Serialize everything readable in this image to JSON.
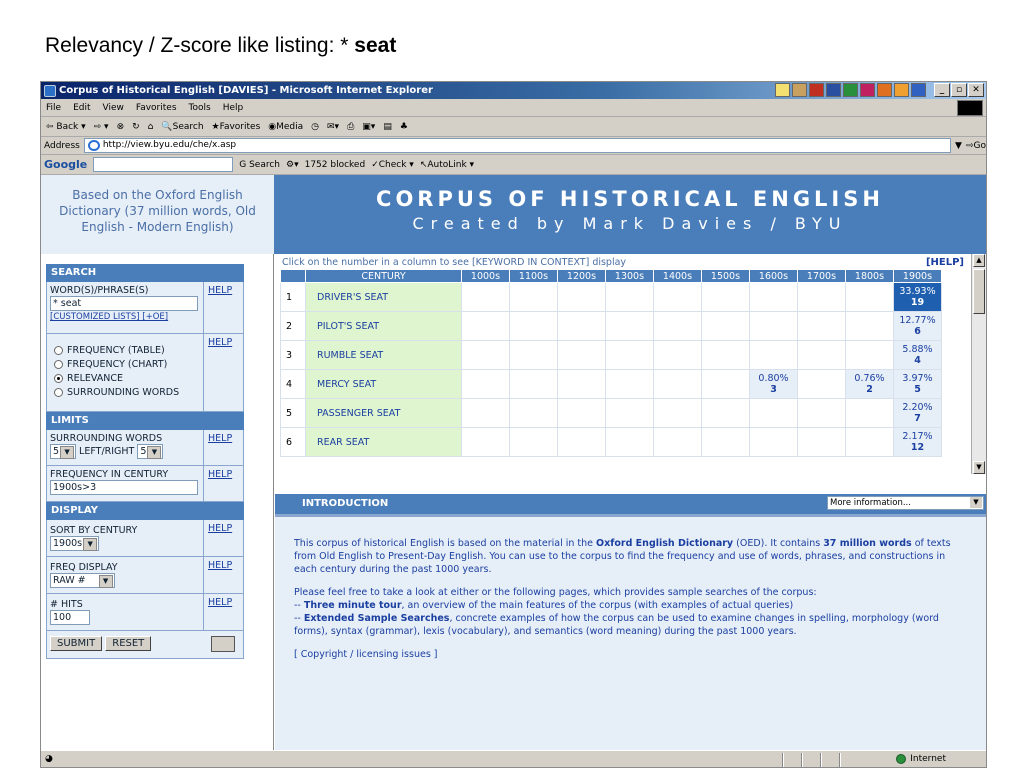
{
  "slide": {
    "title_prefix": "Relevancy / Z-score like listing: * ",
    "title_bold": "seat"
  },
  "window": {
    "title": "Corpus of Historical English [DAVIES] - Microsoft Internet Explorer"
  },
  "menu": [
    "File",
    "Edit",
    "View",
    "Favorites",
    "Tools",
    "Help"
  ],
  "toolbar": [
    "Back",
    "Search",
    "Favorites",
    "Media"
  ],
  "address": {
    "label": "Address",
    "url": "http://view.byu.edu/che/x.asp",
    "go": "Go"
  },
  "googlebar": {
    "logo": "Google",
    "search": "Search",
    "blocked": "1752 blocked",
    "check": "Check",
    "autolink": "AutoLink"
  },
  "banner": {
    "left": "Based on the Oxford English Dictionary (37 million words, Old English - Modern English)",
    "title": "CORPUS OF HISTORICAL ENGLISH",
    "subtitle": "Created by Mark Davies / BYU"
  },
  "left": {
    "search_head": "SEARCH",
    "word_label": "WORD(S)/PHRASE(S)",
    "word_value": "* seat",
    "customized": "[CUSTOMIZED LISTS] [+OE]",
    "help": "HELP",
    "radios": [
      {
        "label": "FREQUENCY (TABLE)",
        "checked": false
      },
      {
        "label": "FREQUENCY (CHART)",
        "checked": false
      },
      {
        "label": "RELEVANCE",
        "checked": true
      },
      {
        "label": "SURROUNDING WORDS",
        "checked": false
      }
    ],
    "limits_head": "LIMITS",
    "surrounding_label": "SURROUNDING WORDS",
    "surr_left": "5",
    "surr_mid": "LEFT/RIGHT",
    "surr_right": "5",
    "freq_label": "FREQUENCY IN CENTURY",
    "freq_value": "1900s>3",
    "display_head": "DISPLAY",
    "sort_label": "SORT BY CENTURY",
    "sort_value": "1900s",
    "freqdisp_label": "FREQ DISPLAY",
    "freqdisp_value": "RAW #",
    "hits_label": "# HITS",
    "hits_value": "100",
    "submit": "SUBMIT",
    "reset": "RESET"
  },
  "results": {
    "note": "Click on the number in a column to see [KEYWORD IN CONTEXT] display",
    "help": "[HELP]",
    "header_word": "CENTURY",
    "centuries": [
      "1000s",
      "1100s",
      "1200s",
      "1300s",
      "1400s",
      "1500s",
      "1600s",
      "1700s",
      "1800s",
      "1900s"
    ],
    "rows": [
      {
        "n": "1",
        "word": "DRIVER'S SEAT",
        "cells": [
          null,
          null,
          null,
          null,
          null,
          null,
          null,
          null,
          null,
          {
            "pct": "33.93%",
            "cnt": "19"
          }
        ]
      },
      {
        "n": "2",
        "word": "PILOT'S SEAT",
        "cells": [
          null,
          null,
          null,
          null,
          null,
          null,
          null,
          null,
          null,
          {
            "pct": "12.77%",
            "cnt": "6"
          }
        ]
      },
      {
        "n": "3",
        "word": "RUMBLE SEAT",
        "cells": [
          null,
          null,
          null,
          null,
          null,
          null,
          null,
          null,
          null,
          {
            "pct": "5.88%",
            "cnt": "4"
          }
        ]
      },
      {
        "n": "4",
        "word": "MERCY SEAT",
        "cells": [
          null,
          null,
          null,
          null,
          null,
          null,
          {
            "pct": "0.80%",
            "cnt": "3"
          },
          null,
          {
            "pct": "0.76%",
            "cnt": "2"
          },
          {
            "pct": "3.97%",
            "cnt": "5"
          }
        ]
      },
      {
        "n": "5",
        "word": "PASSENGER SEAT",
        "cells": [
          null,
          null,
          null,
          null,
          null,
          null,
          null,
          null,
          null,
          {
            "pct": "2.20%",
            "cnt": "7"
          }
        ]
      },
      {
        "n": "6",
        "word": "REAR SEAT",
        "cells": [
          null,
          null,
          null,
          null,
          null,
          null,
          null,
          null,
          null,
          {
            "pct": "2.17%",
            "cnt": "12"
          }
        ]
      }
    ]
  },
  "intro": {
    "bar": "INTRODUCTION",
    "more": "More information...",
    "p1a": "This corpus of historical English is based on the material in the ",
    "p1b": "Oxford English Dictionary",
    "p1c": " (OED). It contains ",
    "p1d": "37 million words",
    "p1e": " of texts from Old English to Present-Day English.  You can use to the corpus to find the frequency and use of words, phrases, and constructions in each century during the past 1000 years.",
    "p2": "Please feel free to take a look at either or the following pages, which provides sample searches of the corpus:",
    "p3a": "-- ",
    "p3b": "Three minute tour",
    "p3c": ", an overview of the main features of the corpus (with examples of actual queries)",
    "p4a": "-- ",
    "p4b": "Extended Sample Searches",
    "p4c": ", concrete examples of how the corpus can be used to examine changes in spelling, morphology (word forms), syntax (grammar), lexis (vocabulary), and semantics (word meaning) during the past 1000 years.",
    "copyright": "[ Copyright / licensing issues ]"
  },
  "status": {
    "zone": "Internet"
  }
}
